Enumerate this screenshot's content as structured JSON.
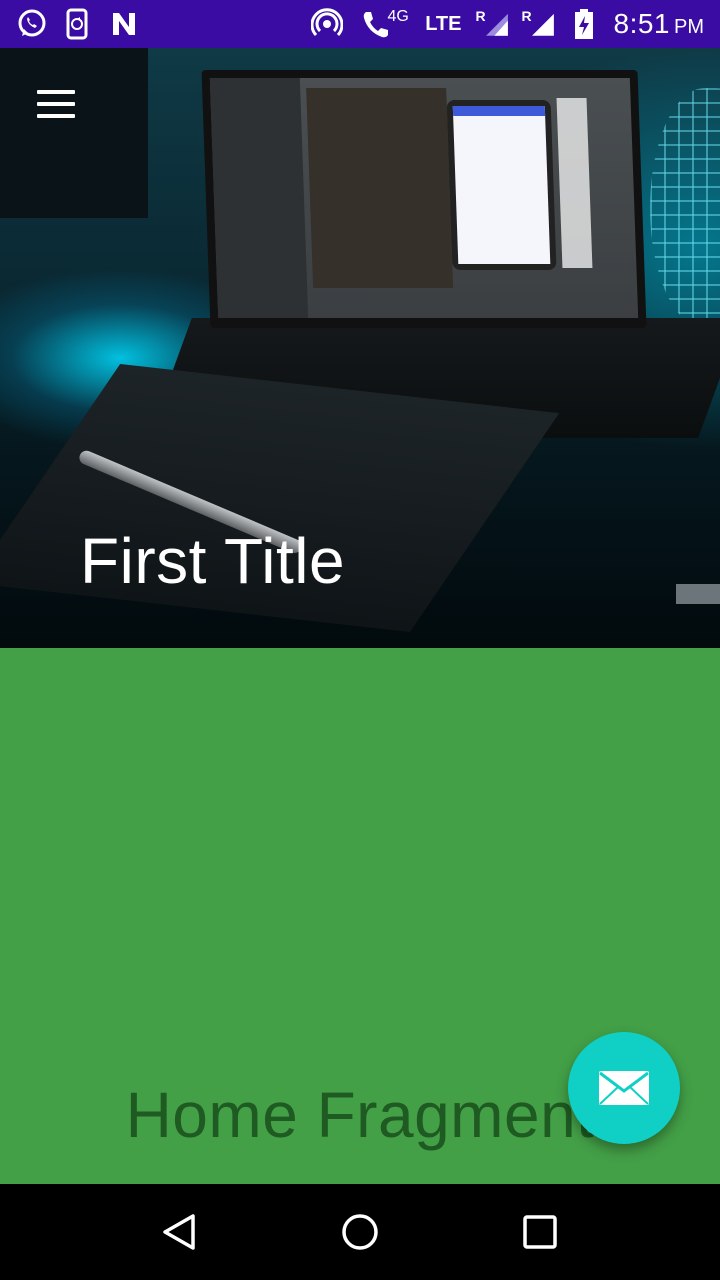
{
  "status_bar": {
    "network_4g": "4G",
    "network_lte": "LTE",
    "roaming_1": "R",
    "roaming_2": "R",
    "time": "8:51",
    "ampm": "PM",
    "color": "#3a0ca3",
    "icons": [
      "whatsapp-icon",
      "phone-sync-icon",
      "n-icon",
      "hotspot-icon",
      "volte-call-icon",
      "signal-icon",
      "signal-icon",
      "battery-charging-icon"
    ]
  },
  "header": {
    "title": "First Title",
    "menu_icon": "hamburger-menu-icon"
  },
  "content": {
    "fragment_label": "Home Fragment",
    "background_color": "#43a047"
  },
  "fab": {
    "icon": "mail-icon",
    "color": "#10d0c6"
  },
  "nav_bar": {
    "back_icon": "back-triangle-icon",
    "home_icon": "home-circle-icon",
    "recents_icon": "recents-square-icon"
  }
}
